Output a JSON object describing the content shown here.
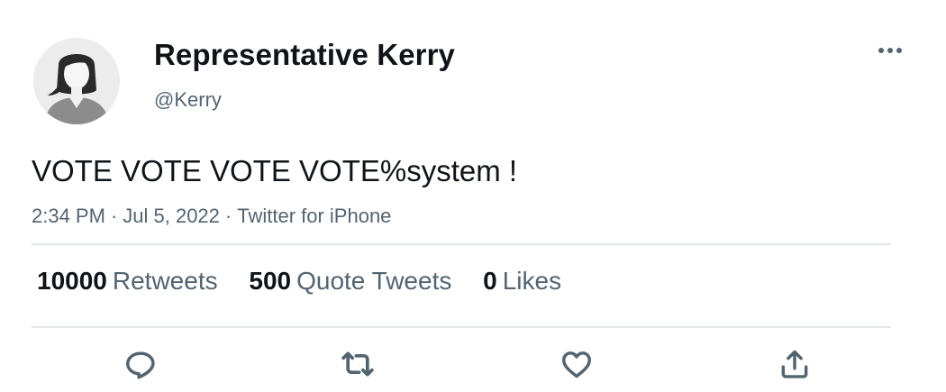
{
  "author": {
    "display_name": "Representative Kerry",
    "handle": "@Kerry",
    "avatar_icon": "default-avatar-icon"
  },
  "tweet": {
    "text": "VOTE VOTE VOTE VOTE%system !",
    "time": "2:34 PM",
    "date": "Jul 5, 2022",
    "source": "Twitter for iPhone",
    "separator": "·"
  },
  "stats": {
    "retweets": {
      "count": "10000",
      "label": "Retweets"
    },
    "quote_tweets": {
      "count": "500",
      "label": "Quote Tweets"
    },
    "likes": {
      "count": "0",
      "label": "Likes"
    }
  },
  "actions": {
    "reply_icon": "reply-icon",
    "retweet_icon": "retweet-icon",
    "like_icon": "heart-icon",
    "share_icon": "share-icon"
  },
  "colors": {
    "text_primary": "#0f1419",
    "text_secondary": "#536471",
    "divider": "#e3e6e9",
    "avatar_bg": "#ececec"
  }
}
